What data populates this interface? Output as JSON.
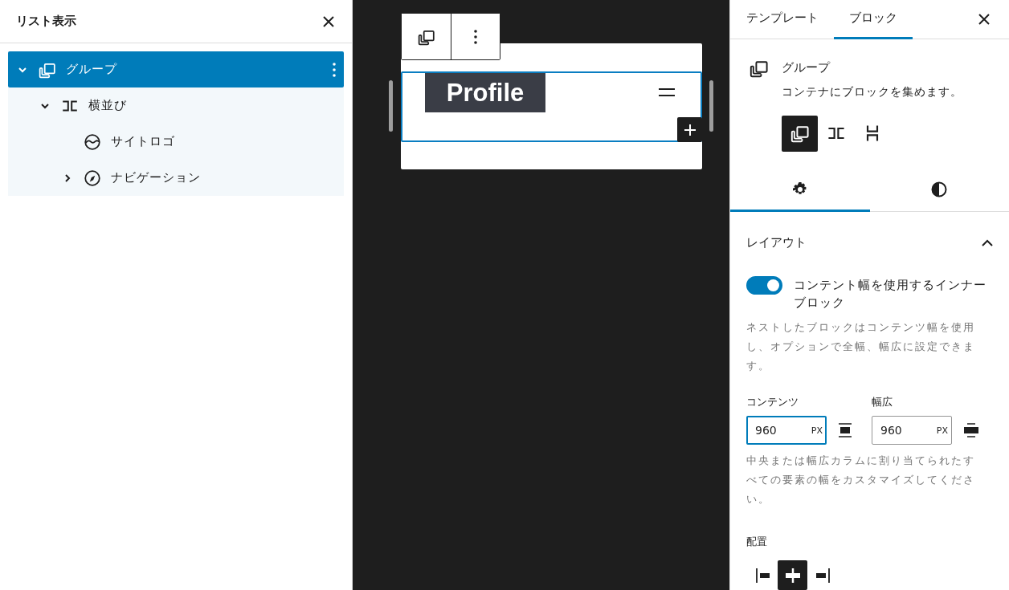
{
  "list_view": {
    "title": "リスト表示",
    "tree": [
      {
        "label": "グループ",
        "kind": "group",
        "selected": true,
        "expanded": true,
        "children": [
          {
            "label": "横並び",
            "kind": "row",
            "selected": false,
            "expanded": true,
            "children": [
              {
                "label": "サイトロゴ",
                "kind": "logo",
                "selected": false
              },
              {
                "label": "ナビゲーション",
                "kind": "navigation",
                "selected": false,
                "expanded": false
              }
            ]
          }
        ]
      }
    ]
  },
  "canvas": {
    "site_title": "Profile"
  },
  "sidebar": {
    "tabs": [
      {
        "label": "テンプレート",
        "selected": false
      },
      {
        "label": "ブロック",
        "selected": true
      }
    ],
    "block": {
      "name": "グループ",
      "description": "コンテナにブロックを集めます。",
      "variations": [
        {
          "kind": "group",
          "selected": true
        },
        {
          "kind": "row",
          "selected": false
        },
        {
          "kind": "stack",
          "selected": false
        }
      ]
    },
    "panel_tabs": [
      {
        "kind": "settings",
        "selected": true
      },
      {
        "kind": "styles",
        "selected": false
      }
    ],
    "layout": {
      "title": "レイアウト",
      "expanded": true,
      "toggle": {
        "label": "コンテント幅を使用するインナーブロック",
        "on": true
      },
      "help": "ネストしたブロックはコンテンツ幅を使用し、オプションで全幅、幅広に設定できます。",
      "fields": [
        {
          "label": "コンテンツ",
          "value": "960",
          "unit": "PX",
          "focused": true,
          "kind": "content"
        },
        {
          "label": "幅広",
          "value": "960",
          "unit": "PX",
          "focused": false,
          "kind": "wide"
        }
      ],
      "help2": "中央または幅広カラムに割り当てられたすべての要素の幅をカスタマイズしてください。",
      "justification": {
        "label": "配置",
        "options": [
          {
            "kind": "left",
            "selected": false
          },
          {
            "kind": "center",
            "selected": true
          },
          {
            "kind": "right",
            "selected": false
          }
        ]
      }
    }
  }
}
